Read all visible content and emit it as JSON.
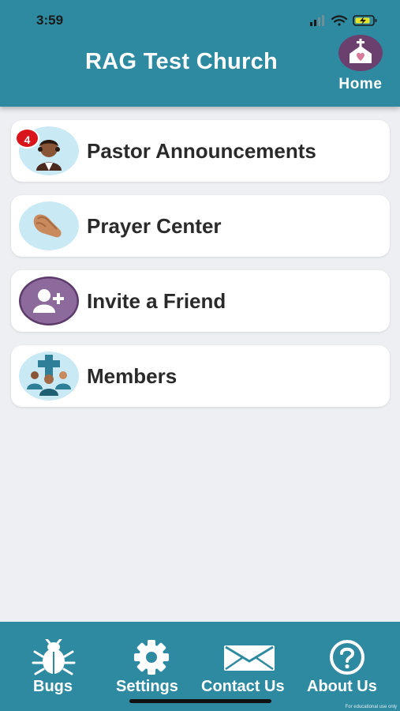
{
  "status_bar": {
    "time": "3:59"
  },
  "header": {
    "title": "RAG Test Church",
    "home_label": "Home"
  },
  "menu": [
    {
      "label": "Pastor Announcements",
      "icon": "pastor-icon",
      "badge": "4"
    },
    {
      "label": "Prayer Center",
      "icon": "praying-hands-icon"
    },
    {
      "label": "Invite a Friend",
      "icon": "add-user-icon"
    },
    {
      "label": "Members",
      "icon": "members-icon"
    }
  ],
  "tabbar": {
    "bugs": "Bugs",
    "settings": "Settings",
    "contact": "Contact Us",
    "about": "About Us"
  },
  "watermark": "For educational use only",
  "colors": {
    "primary": "#2e8aa0",
    "background": "#eeeff3",
    "badge": "#d9151b",
    "home_icon": "#6b3f6e"
  }
}
